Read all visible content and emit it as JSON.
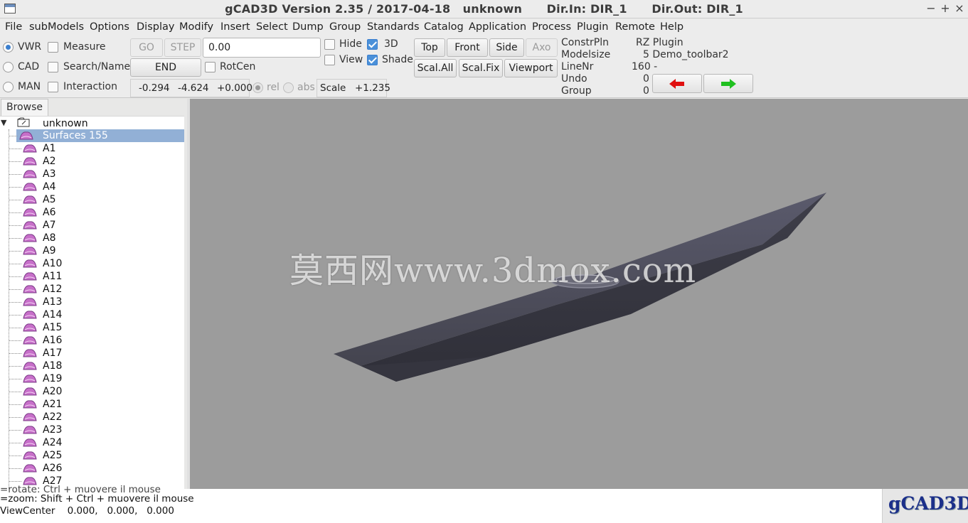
{
  "window": {
    "title": "gCAD3D Version 2.35 / 2017-04-18   unknown      Dir.In: DIR_1      Dir.Out: DIR_1",
    "minimize": "−",
    "maximize": "+",
    "close": "×"
  },
  "menu": [
    "File",
    "subModels",
    "Options",
    "Display",
    "Modify",
    "Insert",
    "Select",
    "Dump",
    "Group",
    "Standards",
    "Catalog",
    "Application",
    "Process",
    "Plugin",
    "Remote",
    "Help"
  ],
  "toolbar": {
    "modes": [
      {
        "label": "VWR",
        "selected": true
      },
      {
        "label": "CAD",
        "selected": false
      },
      {
        "label": "MAN",
        "selected": false
      }
    ],
    "checks": [
      {
        "label": "Measure",
        "checked": false
      },
      {
        "label": "Search/Name",
        "checked": false
      },
      {
        "label": "Interaction",
        "checked": false
      }
    ],
    "go_label": "GO",
    "step_label": "STEP",
    "end_label": "END",
    "value_entry": "0.00",
    "rotcen_label": "RotCen",
    "rotcen_checked": false,
    "hide_label": "Hide",
    "view_label": "View",
    "three_d_label": "3D",
    "shade_label": "Shade",
    "coord_x": "-0.294",
    "coord_y": "-4.624",
    "coord_z": "+0.000",
    "rel_label": "rel",
    "abs_label": "abs",
    "scale_label": "Scale",
    "scale_value": "+1.235",
    "top_label": "Top",
    "front_label": "Front",
    "side_label": "Side",
    "axo_label": "Axo",
    "scalall_label": "Scal.All",
    "scalfix_label": "Scal.Fix",
    "viewport_label": "Viewport"
  },
  "info": {
    "constrpln_label": "ConstrPln",
    "constrpln_value": "RZ Plugin",
    "modelsize_label": "Modelsize",
    "modelsize_value": "5 Demo_toolbar2",
    "linenr_label": "LineNr",
    "linenr_value": "160 -",
    "undo_label": "Undo",
    "undo_value": "0",
    "group_label": "Group",
    "group_value": "0",
    "arrow_back_color": "#e01010",
    "arrow_fwd_color": "#20c020"
  },
  "browser": {
    "tab": "Browse",
    "root": "unknown",
    "surfaces": "Surfaces 155",
    "items": [
      "A1",
      "A2",
      "A3",
      "A4",
      "A5",
      "A6",
      "A7",
      "A8",
      "A9",
      "A10",
      "A11",
      "A12",
      "A13",
      "A14",
      "A15",
      "A16",
      "A17",
      "A18",
      "A19",
      "A20",
      "A21",
      "A22",
      "A23",
      "A24",
      "A25",
      "A26",
      "A27"
    ]
  },
  "viewport": {
    "watermark": "莫西网www.3dmox.com",
    "background": "#9c9c9c",
    "model_color": "#4a4a5a"
  },
  "status": {
    "line1": "=rotate: Ctrl + muovere il mouse",
    "line2": "=zoom: Shift + Ctrl + muovere il mouse",
    "line3": "ViewCenter    0.000,   0.000,   0.000"
  },
  "logo": "gCAD3D"
}
